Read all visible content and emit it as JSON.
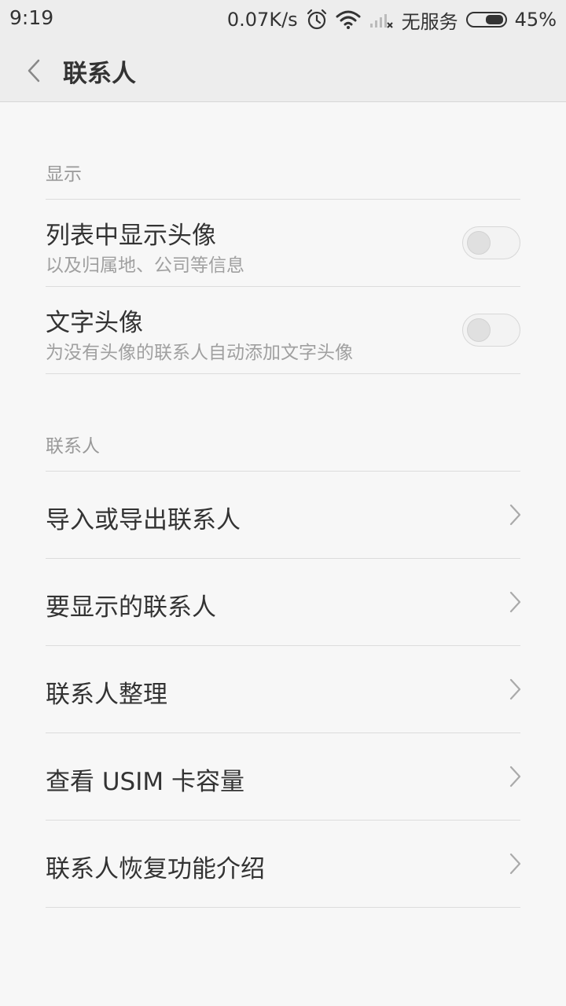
{
  "status_bar": {
    "time": "9:19",
    "speed": "0.07K/s",
    "no_service": "无服务",
    "battery": "45%",
    "battery_level": 0.45,
    "icons": [
      "alarm-icon",
      "wifi-icon",
      "no-signal-icon",
      "battery-icon"
    ]
  },
  "header": {
    "title": "联系人",
    "back_icon": "chevron-left-icon"
  },
  "sections": {
    "display": {
      "label": "显示",
      "items": [
        {
          "title": "列表中显示头像",
          "subtitle": "以及归属地、公司等信息",
          "on": false
        },
        {
          "title": "文字头像",
          "subtitle": "为没有头像的联系人自动添加文字头像",
          "on": false
        }
      ]
    },
    "contacts": {
      "label": "联系人",
      "items": [
        {
          "title": "导入或导出联系人"
        },
        {
          "title": "要显示的联系人"
        },
        {
          "title": "联系人整理"
        },
        {
          "title": "查看 USIM 卡容量"
        },
        {
          "title": "联系人恢复功能介绍"
        }
      ]
    }
  },
  "colors": {
    "background": "#f7f7f7",
    "bar": "#ededed",
    "text": "#333333",
    "secondary_text": "#999999",
    "divider": "#dcdcdc"
  }
}
